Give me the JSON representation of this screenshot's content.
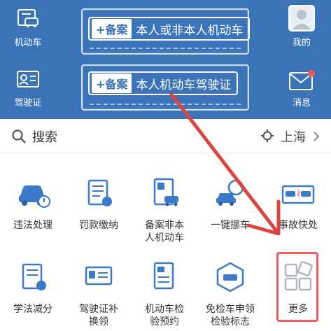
{
  "header": {
    "left": [
      {
        "label": "机动车",
        "icon": "car-document-icon"
      },
      {
        "label": "驾驶证",
        "icon": "id-card-icon"
      }
    ],
    "cards": [
      {
        "tag": "+备案",
        "text": "本人或非本人机动车"
      },
      {
        "tag": "+备案",
        "text": "本人机动车驾驶证"
      }
    ],
    "right": [
      {
        "label": "我的",
        "icon": "user-avatar-icon"
      },
      {
        "label": "消息",
        "icon": "mail-icon"
      }
    ]
  },
  "search": {
    "label": "搜索",
    "city": "上海"
  },
  "grid": {
    "row1": [
      {
        "label": "违法处理",
        "icon": "car-violation-icon"
      },
      {
        "label": "罚款缴纳",
        "icon": "fine-scroll-icon"
      },
      {
        "label": "备案非本\n人机动车",
        "icon": "car-file-icon"
      },
      {
        "label": "一键挪车",
        "icon": "move-car-icon"
      },
      {
        "label": "事故快处",
        "icon": "accident-icon"
      }
    ],
    "row2": [
      {
        "label": "学法减分",
        "icon": "study-book-icon"
      },
      {
        "label": "驾驶证补\n换领",
        "icon": "license-replace-icon"
      },
      {
        "label": "机动车检\n验预约",
        "icon": "inspection-booking-icon"
      },
      {
        "label": "免检车申领\n检验标志",
        "icon": "exempt-badge-icon"
      },
      {
        "label": "更多",
        "icon": "more-grid-icon"
      }
    ]
  },
  "colors": {
    "header_bg": "#3a73b6",
    "accent_red": "#ee5c5c",
    "icon_blue": "#3b7ac8"
  }
}
